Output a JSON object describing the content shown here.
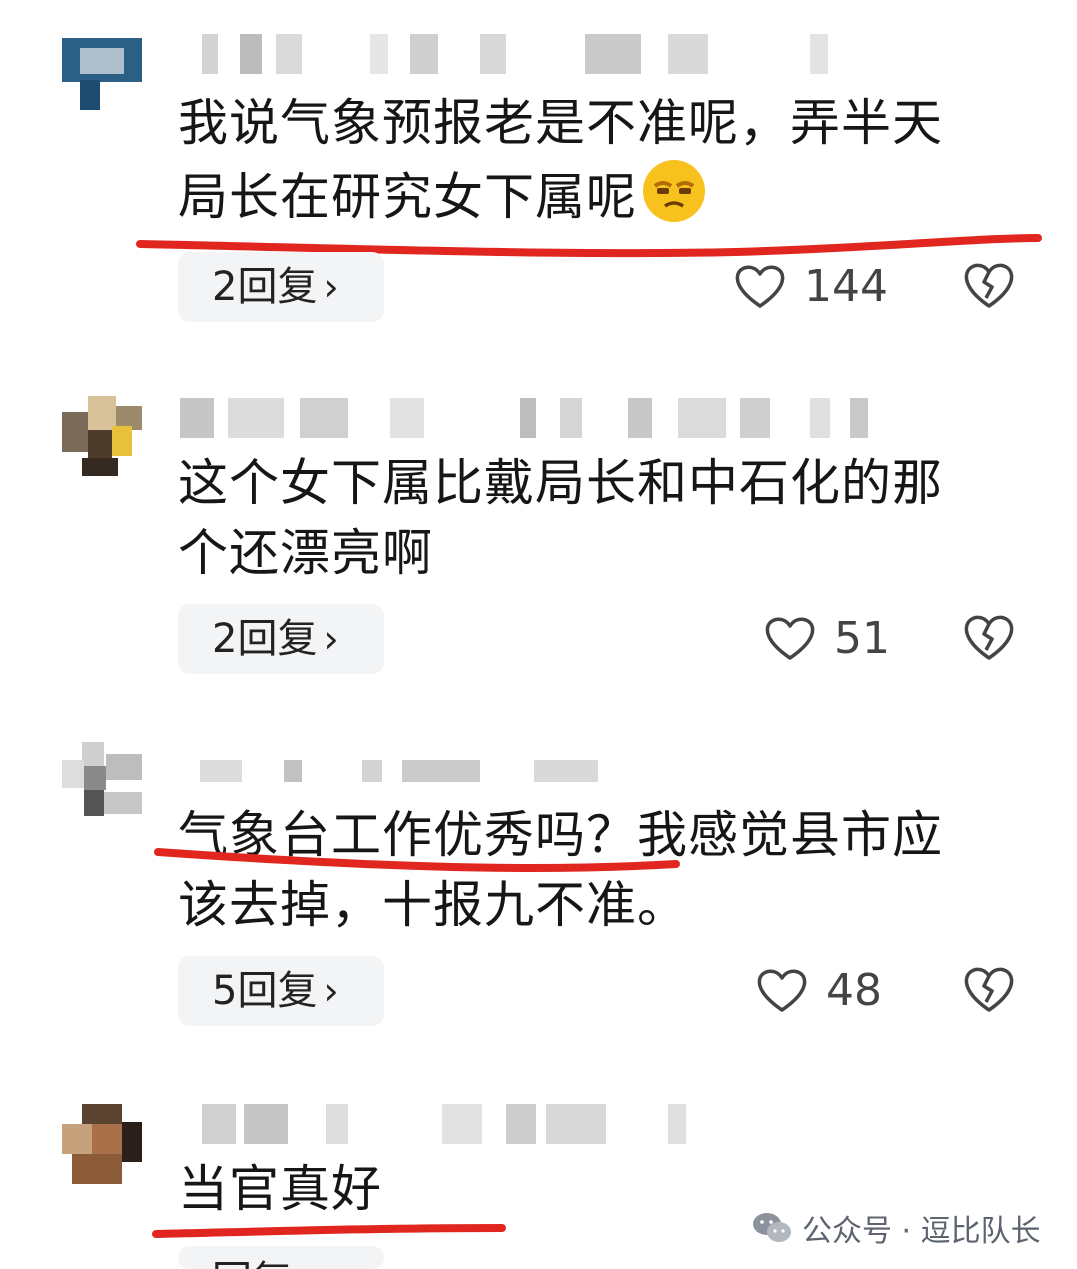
{
  "comments": [
    {
      "text_line1": "我说气象预报老是不准呢，弄半天",
      "text_line2": "局长在研究女下属呢",
      "emoji": "unamused-face-icon",
      "reply_label": "2回复",
      "likes": "144"
    },
    {
      "text_line1": "这个女下属比戴局长和中石化的那",
      "text_line2": "个还漂亮啊",
      "reply_label": "2回复",
      "likes": "51"
    },
    {
      "text_line1": "气象台工作优秀吗？我感觉县市应",
      "text_line2": "该去掉，十报九不准。",
      "reply_label": "5回复",
      "likes": "48"
    },
    {
      "text_line1": "当官真好",
      "reply_label": "回复"
    }
  ],
  "watermark": {
    "text": "公众号 · 逗比队长",
    "icon": "wechat-icon"
  },
  "colors": {
    "underline": "#e0261f",
    "reply_bg": "#f2f4f5",
    "icon_gray": "#444444"
  }
}
